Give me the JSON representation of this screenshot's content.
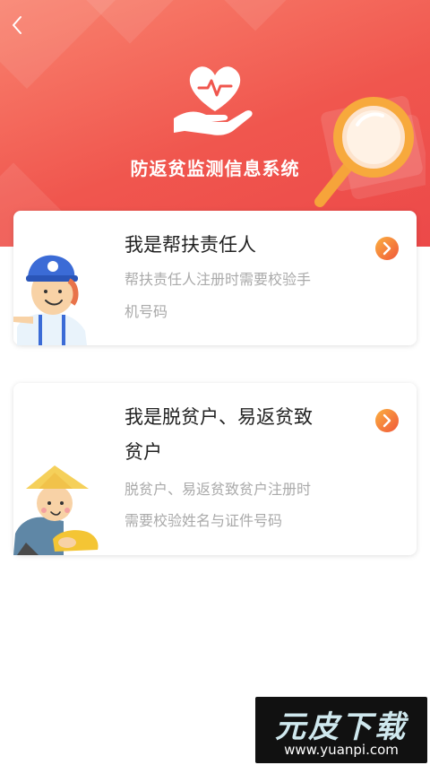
{
  "header": {
    "title": "防返贫监测信息系统",
    "back_icon": "chevron-left-icon",
    "logo_icon": "heart-in-hand-icon",
    "decor_icon": "magnifier-icon"
  },
  "cards": [
    {
      "title": "我是帮扶责任人",
      "desc_line1": "帮扶责任人注册时需要校验手",
      "desc_line2": "机号码",
      "figure_icon": "worker-helmet-avatar-icon",
      "arrow_icon": "chevron-right-circle-icon"
    },
    {
      "title_line1": "我是脱贫户、易返贫致",
      "title_line2": "贫户",
      "desc_line1": "脱贫户、易返贫致贫户注册时",
      "desc_line2": "需要校验姓名与证件号码",
      "figure_icon": "farmer-straw-hat-avatar-icon",
      "arrow_icon": "chevron-right-circle-icon"
    }
  ],
  "watermark": {
    "brand": "元皮下载",
    "url": "www.yuanpi.com"
  },
  "colors": {
    "header_gradient_start": "#f9826e",
    "header_gradient_end": "#ec4949",
    "arrow_start": "#fbb040",
    "arrow_end": "#f0573a"
  }
}
